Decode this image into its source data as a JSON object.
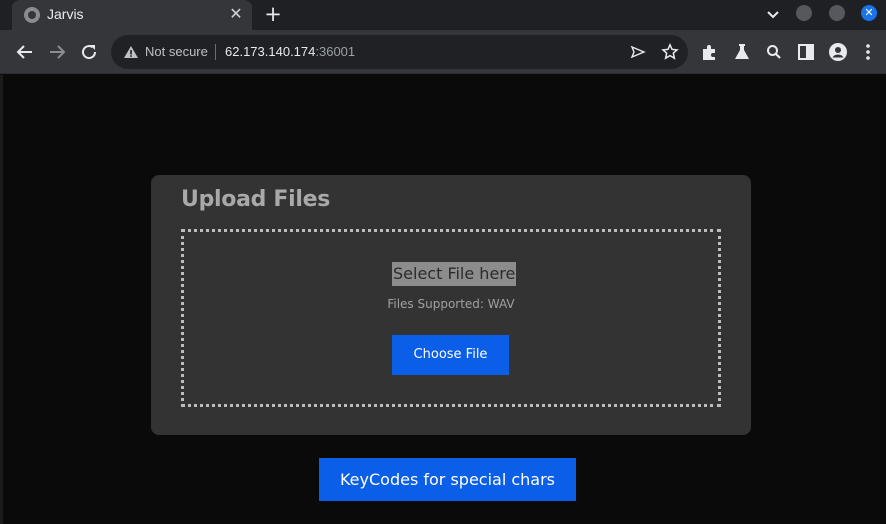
{
  "browser": {
    "tab": {
      "title": "Jarvis",
      "close_glyph": "✕"
    },
    "new_tab_glyph": "+",
    "window": {
      "close_glyph": "✕"
    },
    "address": {
      "security_text": "Not secure",
      "url_host": "62.173.140.174",
      "url_port": ":36001"
    },
    "colors": {
      "accent": "#1a73e8",
      "toolbar": "#35363a",
      "tabstrip": "#1f2023"
    }
  },
  "upload": {
    "title": "Upload Files",
    "select_label": "Select File here",
    "supported_text": "Files Supported: WAV",
    "choose_button": "Choose File"
  },
  "keycodes_button": "KeyCodes for special chars",
  "colors": {
    "button_blue": "#0b5ee8",
    "card_bg": "#333333",
    "page_bg": "#0a0a0a"
  }
}
